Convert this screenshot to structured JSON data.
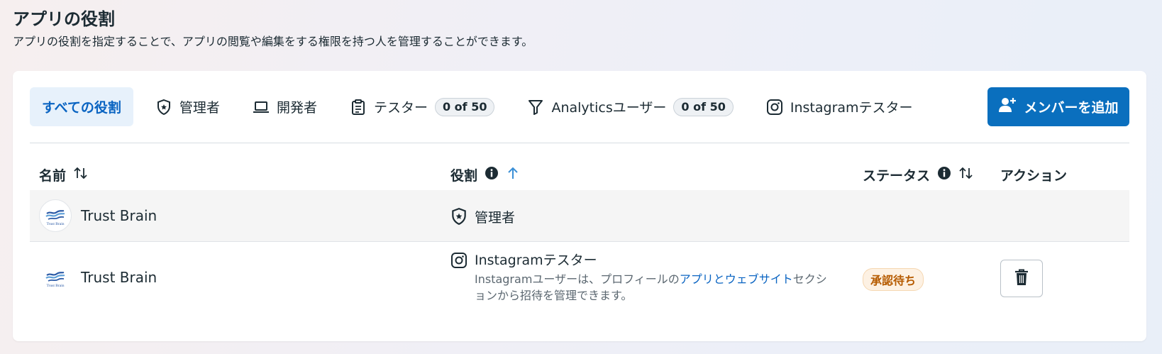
{
  "header": {
    "title": "アプリの役割",
    "subtitle": "アプリの役割を指定することで、アプリの閲覧や編集をする権限を持つ人を管理することができます。"
  },
  "tabs": [
    {
      "label": "すべての役割",
      "active": true
    },
    {
      "label": "管理者",
      "icon": "shield-star-icon"
    },
    {
      "label": "開発者",
      "icon": "laptop-icon"
    },
    {
      "label": "テスター",
      "icon": "clipboard-icon",
      "count": "0 of 50"
    },
    {
      "label": "Analyticsユーザー",
      "icon": "funnel-icon",
      "count": "0 of 50"
    },
    {
      "label": "Instagramテスター",
      "icon": "instagram-icon"
    }
  ],
  "add_button": {
    "label": "メンバーを追加",
    "icon": "add-user-icon"
  },
  "table": {
    "columns": {
      "name": "名前",
      "role": "役割",
      "status": "ステータス",
      "action": "アクション"
    },
    "rows": [
      {
        "name": "Trust Brain",
        "avatar_text": "Trust Brain",
        "role": "管理者",
        "role_icon": "shield-star-icon"
      },
      {
        "name": "Trust Brain",
        "avatar_text": "Trust Brain",
        "role": "Instagramテスター",
        "role_icon": "instagram-icon",
        "role_desc_pre": "Instagramユーザーは、プロフィールの",
        "role_desc_link": "アプリとウェブサイト",
        "role_desc_post": "セクションから招待を管理できます。",
        "status": "承認待ち",
        "action_icon": "trash-icon"
      }
    ]
  },
  "colors": {
    "accent": "#0a6fbe",
    "active_tab_bg": "#e7f1fb",
    "pending": "#b65b00"
  }
}
